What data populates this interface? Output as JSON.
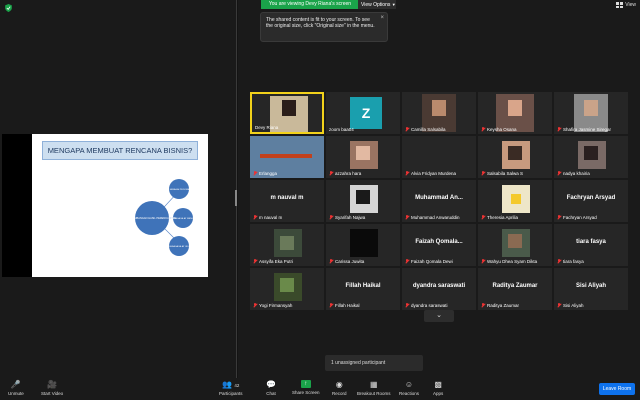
{
  "top": {
    "viewing_banner": "You are viewing Devy Riana's screen",
    "view_options": "View Options",
    "view_label": "View"
  },
  "tooltip": {
    "text": "The shared content is fit to your screen. To see the original size, click \"Original size\" in the menu."
  },
  "slide": {
    "title": "MENGAPA MEMBUAT RENCANA BISNIS?",
    "center_label": "1. SUMBANGAN HASIL PERENCANAAN",
    "node1": "2. SEBAGAI PEDOMAN",
    "node2": "3. SEBAGAI ALAT MENJUAL",
    "node3": "4. SEBAGAI ALAT UKUR"
  },
  "gallery": {
    "tiles": [
      {
        "name": "Devy Riana",
        "muted": false
      },
      {
        "name": "zoom baa04",
        "muted": false,
        "avatar": "Z"
      },
      {
        "name": "Camilla Salsabila",
        "muted": true
      },
      {
        "name": "Keysha Osana",
        "muted": true
      },
      {
        "name": "Shafira Jasmine Siregar",
        "muted": true
      },
      {
        "name": "Erlangga",
        "muted": true
      },
      {
        "name": "azzahra hara",
        "muted": true
      },
      {
        "name": "Alvia Fridyan Murdena",
        "muted": true
      },
      {
        "name": "Salsabila Salwa S",
        "muted": true
      },
      {
        "name": "nadya khairia",
        "muted": true
      },
      {
        "name": "m nauval m",
        "muted": true,
        "big": "m nauval m"
      },
      {
        "name": "Syarifah Najwa",
        "muted": true
      },
      {
        "name": "Muhammad Anwaruddin",
        "muted": true,
        "big": "Muhammad  An..."
      },
      {
        "name": "Theresia Aprilia",
        "muted": true
      },
      {
        "name": "Fachryan Arsyad",
        "muted": true,
        "big": "Fachryan Arsyad"
      },
      {
        "name": "Assyifa Eka Putri",
        "muted": true
      },
      {
        "name": "Carissa Juwita",
        "muted": true
      },
      {
        "name": "Faizah Qomala Dewi",
        "muted": true,
        "big": "Faizah  Qomala..."
      },
      {
        "name": "Wahyu Dhea Syam Dikta",
        "muted": true
      },
      {
        "name": "tiara fasya",
        "muted": true,
        "big": "tiara fasya"
      },
      {
        "name": "Yogi Firmansyah",
        "muted": true
      },
      {
        "name": "Fillah Haikal",
        "muted": true,
        "big": "Fillah Haikal"
      },
      {
        "name": "dyandra saraswati",
        "muted": true,
        "big": "dyandra saraswati"
      },
      {
        "name": "Raditya Zaumar",
        "muted": true,
        "big": "Raditya Zaumar"
      },
      {
        "name": "Sisi Aliyah",
        "muted": true,
        "big": "Sisi Aliyah"
      }
    ]
  },
  "unassigned": "1 unassigned participant",
  "toolbar": {
    "unmute": "Unmute",
    "start_video": "Start Video",
    "participants": "Participants",
    "participants_count": "42",
    "chat": "Chat",
    "share_screen": "Share Screen",
    "record": "Record",
    "breakout_rooms": "Breakout Rooms",
    "reactions": "Reactions",
    "apps": "Apps",
    "leave_room": "Leave Room"
  },
  "colors": {
    "share_green": "#1aa34a",
    "leave_blue": "#0e72ed",
    "active_speaker": "#f2d21b"
  }
}
